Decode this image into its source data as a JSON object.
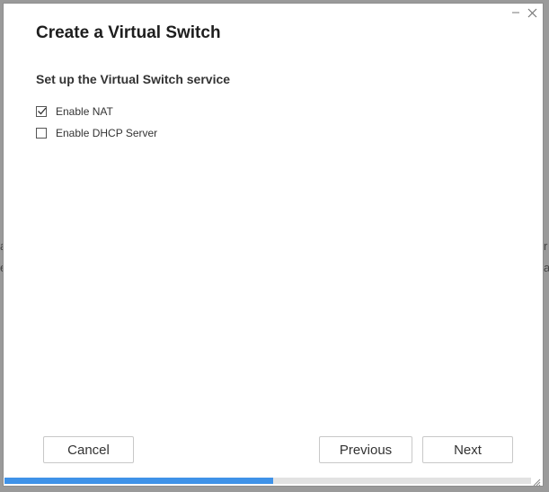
{
  "backdrop": {
    "left_lines": [
      "a",
      "e"
    ],
    "right_lines": [
      "r",
      "a"
    ]
  },
  "dialog": {
    "title": "Create a Virtual Switch",
    "subtitle": "Set up the Virtual Switch service",
    "options": [
      {
        "label": "Enable NAT",
        "checked": true
      },
      {
        "label": "Enable DHCP Server",
        "checked": false
      }
    ],
    "buttons": {
      "cancel": "Cancel",
      "previous": "Previous",
      "next": "Next"
    },
    "progress_fraction": 0.51,
    "icons": {
      "minimize": "minimize-icon",
      "close": "close-icon",
      "checkmark": "checkmark-icon",
      "resize": "resize-grip-icon"
    },
    "colors": {
      "progress": "#3f92e8",
      "progress_track": "#e2e2e2"
    }
  }
}
